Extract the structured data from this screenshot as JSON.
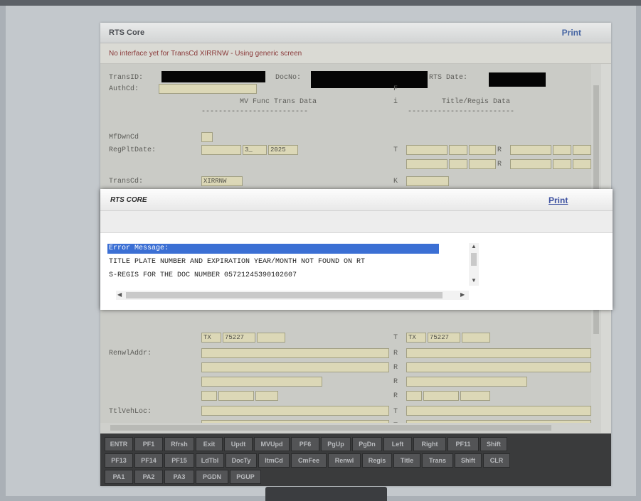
{
  "window": {
    "title": "RTS Core",
    "print_label": "Print",
    "warning": "No interface yet for TransCd XIRRNW - Using generic screen"
  },
  "screen": {
    "transid_label": "TransID:",
    "docno_label": "DocNo:",
    "rtsdate_label": "RTS Date:",
    "authcd_label": "AuthCd:",
    "f_col": "F",
    "i_col": "i",
    "mv_header": "MV Func Trans Data",
    "title_header": "Title/Regis Data",
    "mv_rule": "-------------------------",
    "title_rule": "-------------------------",
    "mfdwncd_label": "MfDwnCd",
    "regpltdate_label": "RegPltDate:",
    "regplt_month": "3_",
    "regplt_year": "2025",
    "t_col": "T",
    "r_col": "R",
    "k_col": "K",
    "transcd_label": "TransCd:",
    "transcd_value": "XIRRNW",
    "state_left": "TX",
    "zip_left": "75227",
    "state_right": "TX",
    "zip_right": "75227",
    "renwladdr_label": "RenwlAddr:",
    "ttlvehloc_label": "TtlVehLoc:"
  },
  "function_keys": {
    "row1": [
      "ENTR",
      "PF1",
      "Rfrsh",
      "Exit",
      "Updt",
      "MVUpd",
      "PF6",
      "PgUp",
      "PgDn",
      "Left",
      "Right",
      "PF11",
      "Shift"
    ],
    "row2": [
      "PF13",
      "PF14",
      "PF15",
      "LdTbl",
      "DocTy",
      "ItmCd",
      "CmFee",
      "Renwl",
      "Regis",
      "Title",
      "Trans",
      "Shift",
      "CLR"
    ],
    "row3": [
      "PA1",
      "PA2",
      "PA3",
      "PGDN",
      "PGUP"
    ]
  },
  "dialog": {
    "title": "RTS CORE",
    "print_label": "Print",
    "message_header": "Error Message:",
    "message_line1": "TITLE PLATE NUMBER AND EXPIRATION YEAR/MONTH NOT FOUND ON RT",
    "message_line2": "S-REGIS FOR THE DOC NUMBER 05721245390102607"
  },
  "colors": {
    "field_fill": "#dcd8b7",
    "highlight": "#3b6fd4",
    "link": "#3b4fa0",
    "warning_text": "#8a3a3a"
  }
}
